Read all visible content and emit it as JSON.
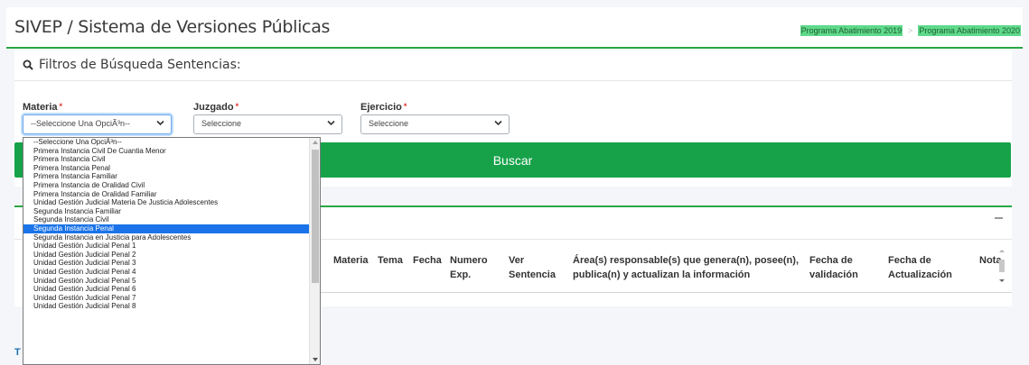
{
  "header": {
    "title": "SIVEP / Sistema de Versiones Públicas",
    "programs": [
      "Programa Abatimiento 2019",
      "Programa Abatimiento 2020"
    ],
    "program_separator": ">"
  },
  "filters": {
    "title": "Filtros de Búsqueda Sentencias:",
    "materia": {
      "label": "Materia",
      "required": "*",
      "value": "--Seleccione Una OpciÃ³n--"
    },
    "juzgado": {
      "label": "Juzgado",
      "required": "*",
      "value": "Seleccione"
    },
    "ejercicio": {
      "label": "Ejercicio",
      "required": "*",
      "value": "Seleccione"
    },
    "search_button": "Buscar"
  },
  "materia_options": [
    "--Seleccione Una OpciÃ³n--",
    "Primera Instancia Civil De Cuantia Menor",
    "Primera Instancia Civil",
    "Primera Instancia Penal",
    "Primera Instancia Familiar",
    "Primera Instancia de Oralidad Civil",
    "Primera Instancia de Oralidad Familiar",
    "Unidad Gestión Judicial Materia De Justicia Adolescentes",
    "Segunda Instancia Familiar",
    "Segunda Instancia Civil",
    "Segunda Instancia Penal",
    "Segunda Instancia en Justicia para Adolescentes",
    "Unidad Gestión Judicial Penal 1",
    "Unidad Gestión Judicial Penal 2",
    "Unidad Gestión Judicial Penal 3",
    "Unidad Gestión Judicial Penal 4",
    "Unidad Gestión Judicial Penal 5",
    "Unidad Gestión Judicial Penal 6",
    "Unidad Gestión Judicial Penal 7",
    "Unidad Gestión Judicial Penal 8"
  ],
  "highlighted_option": "Segunda Instancia Penal",
  "results": {
    "columns": [
      "Materia",
      "Tema",
      "Fecha",
      "Numero Exp.",
      "Ver Sentencia",
      "Área(s) responsable(s) que genera(n), posee(n), publica(n) y actualizan la información",
      "Fecha de validación",
      "Fecha de Actualización",
      "Nota"
    ]
  },
  "footer": {
    "partial_text": "T"
  },
  "colors": {
    "accent_green": "#28a745",
    "button_green": "#17a24a",
    "highlight_blue": "#1a73e8",
    "program_link_bg": "#5fd98a"
  }
}
